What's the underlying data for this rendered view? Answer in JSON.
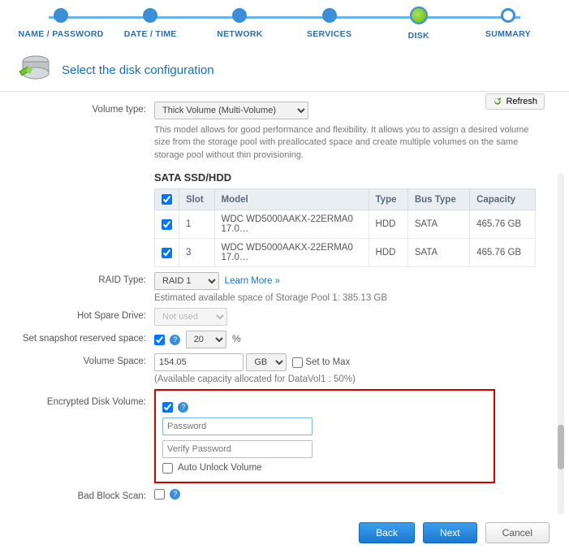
{
  "stepper": {
    "steps": [
      {
        "label": "NAME / PASSWORD",
        "state": "done"
      },
      {
        "label": "DATE / TIME",
        "state": "done"
      },
      {
        "label": "NETWORK",
        "state": "done"
      },
      {
        "label": "SERVICES",
        "state": "done"
      },
      {
        "label": "DISK",
        "state": "active"
      },
      {
        "label": "SUMMARY",
        "state": "pending"
      }
    ]
  },
  "header": {
    "title": "Select the disk configuration"
  },
  "toolbar": {
    "refresh_label": "Refresh"
  },
  "labels": {
    "volume_type": "Volume type:",
    "raid_type": "RAID Type:",
    "hot_spare": "Hot Spare Drive:",
    "snapshot_space": "Set snapshot reserved space:",
    "volume_space": "Volume Space:",
    "encrypted": "Encrypted Disk Volume:",
    "bad_block": "Bad Block Scan:"
  },
  "volume_type": {
    "selected": "Thick Volume (Multi-Volume)",
    "description": "This model allows for good performance and flexibility. It allows you to assign a desired volume size from the storage pool with preallocated space and create multiple volumes on the same storage pool without thin provisioning."
  },
  "disk_section": {
    "title": "SATA SSD/HDD",
    "columns": {
      "slot": "Slot",
      "model": "Model",
      "type": "Type",
      "bus": "Bus Type",
      "capacity": "Capacity"
    },
    "rows": [
      {
        "slot": "1",
        "model": "WDC WD5000AAKX-22ERMA0 17.0…",
        "type": "HDD",
        "bus": "SATA",
        "capacity": "465.76 GB",
        "checked": true
      },
      {
        "slot": "3",
        "model": "WDC WD5000AAKX-22ERMA0 17.0…",
        "type": "HDD",
        "bus": "SATA",
        "capacity": "465.76 GB",
        "checked": true
      }
    ]
  },
  "raid": {
    "selected": "RAID 1",
    "learn_more": "Learn More »",
    "estimated": "Estimated available space of Storage Pool 1: 385.13 GB"
  },
  "hot_spare": {
    "selected": "Not used"
  },
  "snapshot": {
    "enabled": true,
    "value": "20",
    "suffix": "%"
  },
  "volume_space": {
    "value": "154.05",
    "unit": "GB",
    "set_to_max_label": "Set to Max",
    "allocation_note": "(Available capacity allocated for DataVol1 : 50%)"
  },
  "encrypted": {
    "enabled": true,
    "password_placeholder": "Password",
    "verify_placeholder": "Verify Password",
    "auto_unlock_label": "Auto Unlock Volume",
    "auto_unlock_checked": false
  },
  "bad_block": {
    "enabled": false
  },
  "footer": {
    "back": "Back",
    "next": "Next",
    "cancel": "Cancel"
  }
}
